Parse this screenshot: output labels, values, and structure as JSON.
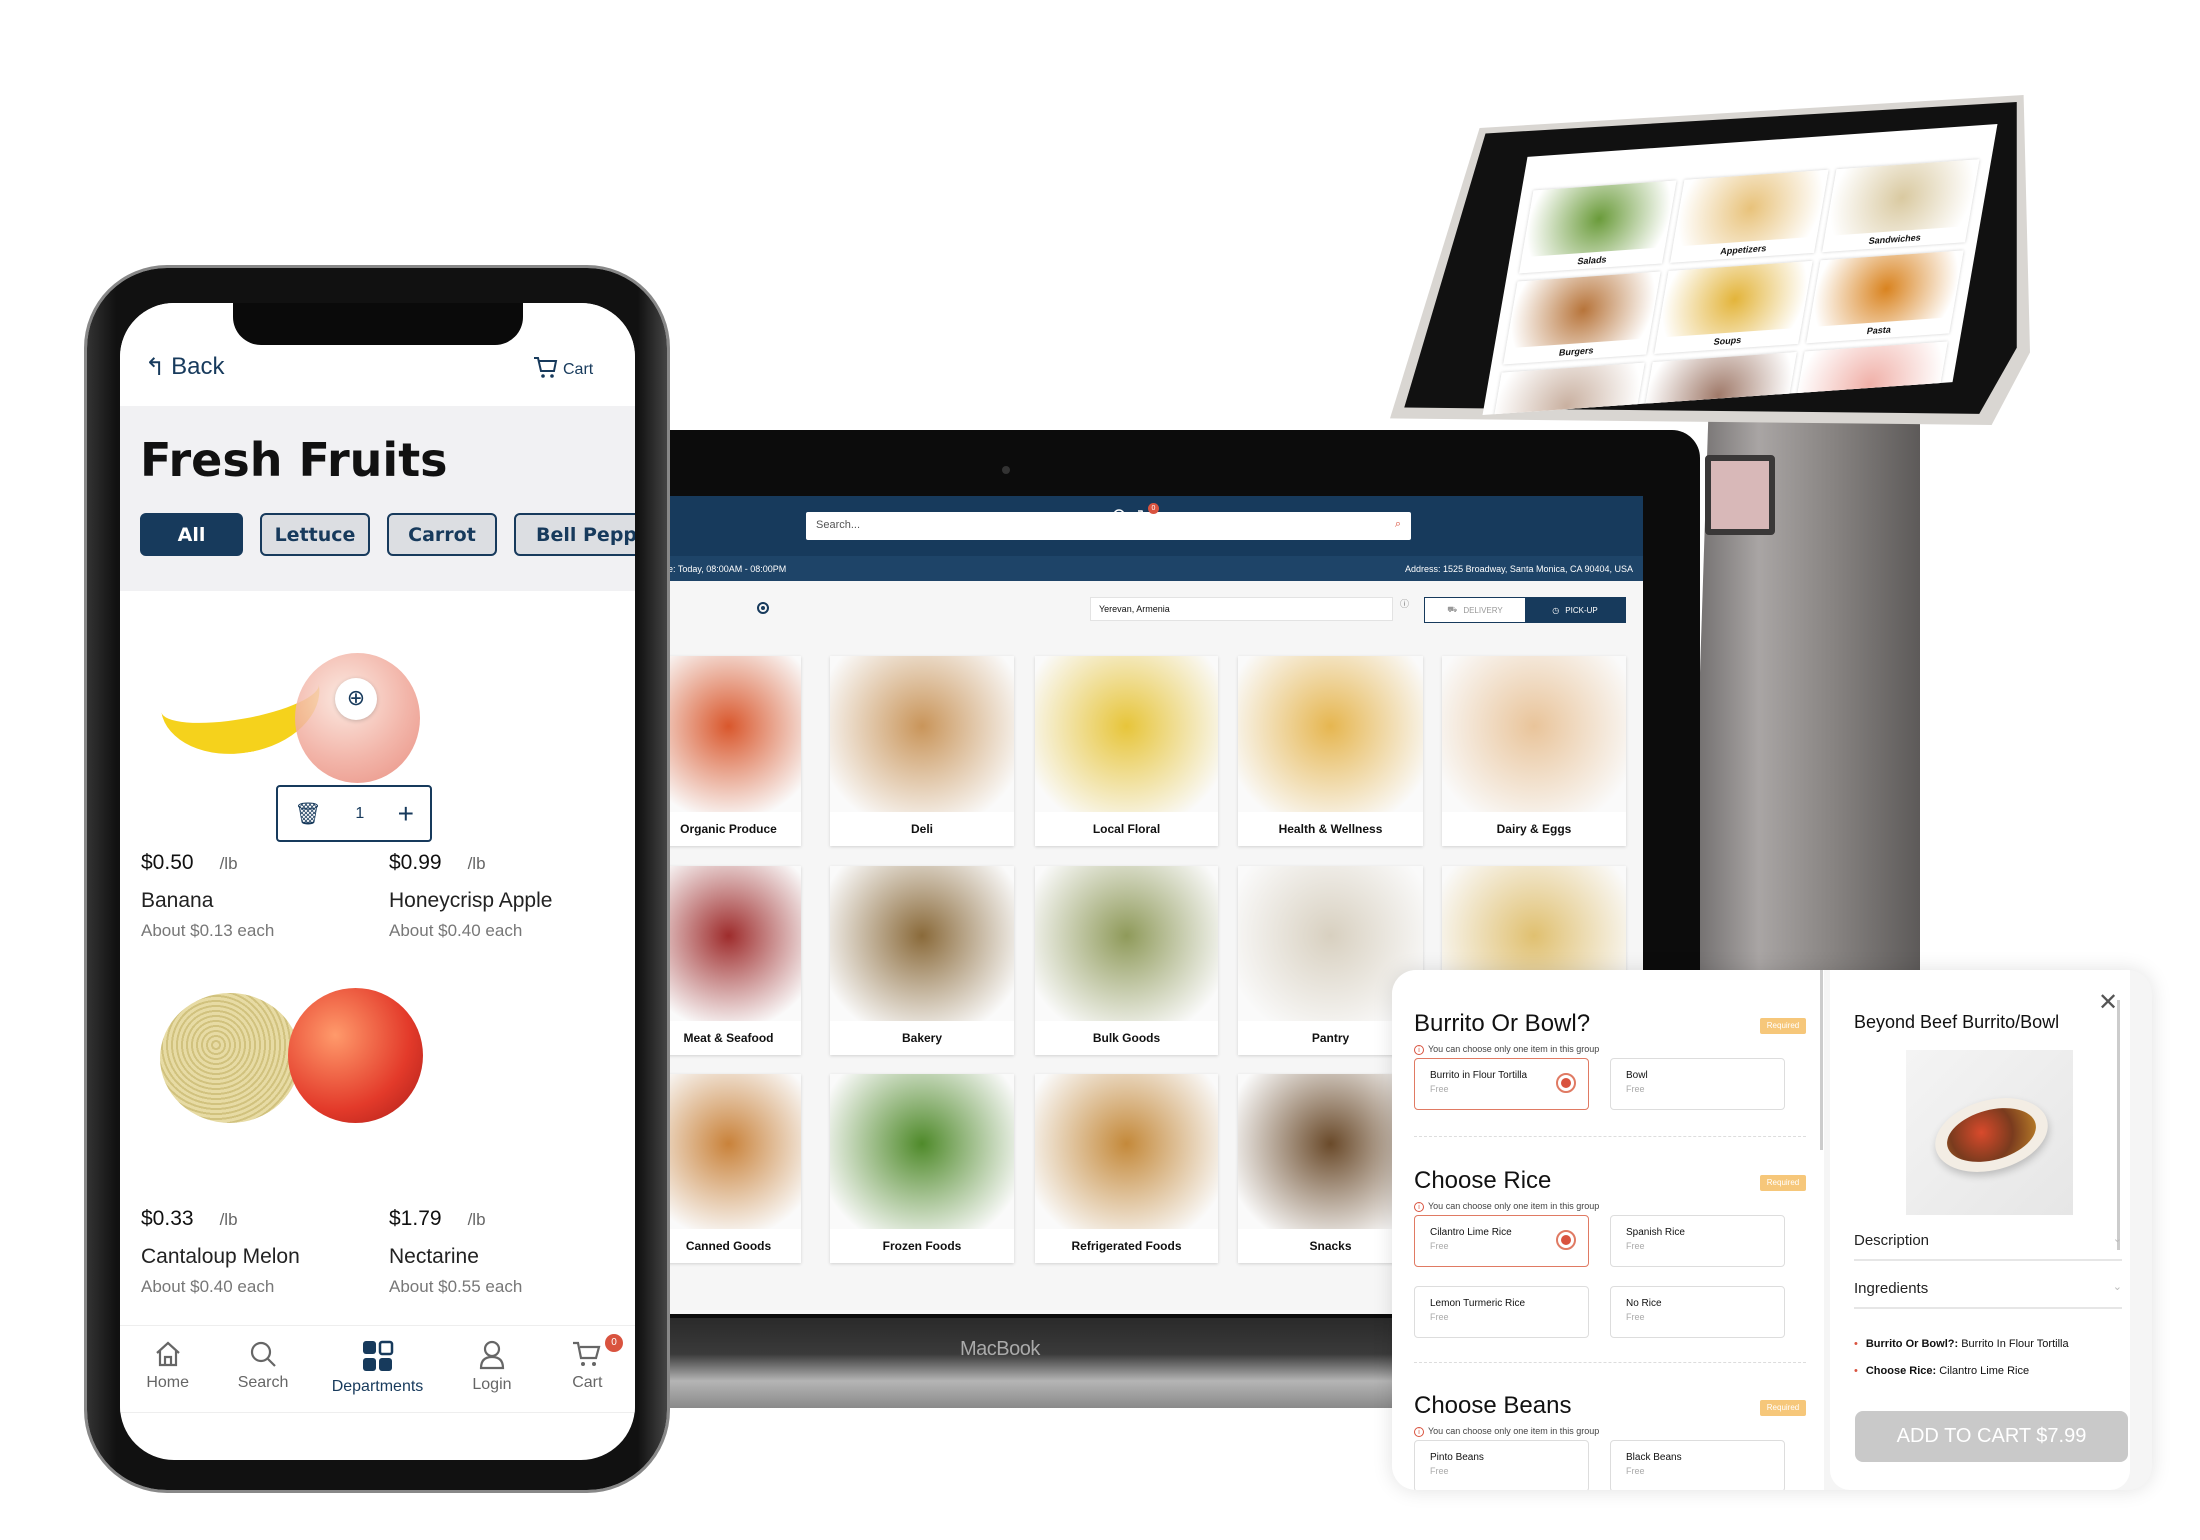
{
  "colors": {
    "brand": "#173a5c",
    "accent": "#d9533f",
    "required": "#f6c77a"
  },
  "kiosk": {
    "categories": [
      "Salads",
      "Appetizers",
      "Sandwiches",
      "Burgers",
      "Soups",
      "Pasta",
      "",
      "",
      ""
    ]
  },
  "laptop": {
    "search_placeholder": "Search...",
    "cart_count": "0",
    "hours": "le: Today, 08:00AM - 08:00PM",
    "address": "Address: 1525 Broadway, Santa Monica, CA 90404, USA",
    "location": "Yerevan, Armenia",
    "delivery": "DELIVERY",
    "pickup": "PICK-UP",
    "brand_label": "MacBook",
    "categories": [
      "Organic Produce",
      "Deli",
      "Local Floral",
      "Health & Wellness",
      "Dairy & Eggs",
      "Meat & Seafood",
      "Bakery",
      "Bulk Goods",
      "Pantry",
      "",
      "Canned Goods",
      "Frozen Foods",
      "Refrigerated Foods",
      "Snacks",
      ""
    ]
  },
  "modal": {
    "groups": [
      {
        "title": "Burrito Or Bowl?",
        "required": "Required",
        "info": "You can choose only one item in this group",
        "options": [
          {
            "name": "Burrito in Flour Tortilla",
            "price": "Free",
            "selected": true
          },
          {
            "name": "Bowl",
            "price": "Free",
            "selected": false
          }
        ]
      },
      {
        "title": "Choose Rice",
        "required": "Required",
        "info": "You can choose only one item in this group",
        "options": [
          {
            "name": "Cilantro Lime Rice",
            "price": "Free",
            "selected": true
          },
          {
            "name": "Spanish Rice",
            "price": "Free",
            "selected": false
          },
          {
            "name": "Lemon Turmeric Rice",
            "price": "Free",
            "selected": false
          },
          {
            "name": "No Rice",
            "price": "Free",
            "selected": false
          }
        ]
      },
      {
        "title": "Choose Beans",
        "required": "Required",
        "info": "You can choose only one item in this group",
        "options": [
          {
            "name": "Pinto Beans",
            "price": "Free",
            "selected": false
          },
          {
            "name": "Black Beans",
            "price": "Free",
            "selected": false
          }
        ]
      }
    ],
    "item_title": "Beyond Beef Burrito/Bowl",
    "description": "Description",
    "ingredients": "Ingredients",
    "summary": [
      {
        "label": "Burrito Or Bowl?:",
        "value": "Burrito In Flour Tortilla"
      },
      {
        "label": "Choose Rice:",
        "value": "Cilantro Lime Rice"
      }
    ],
    "add_to_cart": "ADD TO CART $7.99"
  },
  "phone": {
    "back": "Back",
    "cart": "Cart",
    "title": "Fresh Fruits",
    "chips": [
      "All",
      "Lettuce",
      "Carrot",
      "Bell Pepp"
    ],
    "products": [
      {
        "price": "$0.50",
        "unit": "/lb",
        "name": "Banana",
        "about": "About $0.13 each"
      },
      {
        "price": "$0.99",
        "unit": "/lb",
        "name": "Honeycrisp Apple",
        "about": "About $0.40 each",
        "qty": "1"
      },
      {
        "price": "$0.33",
        "unit": "/lb",
        "name": "Cantaloup Melon",
        "about": "About $0.40 each"
      },
      {
        "price": "$1.79",
        "unit": "/lb",
        "name": "Nectarine",
        "about": "About $0.55 each"
      }
    ],
    "tabs": [
      "Home",
      "Search",
      "Departments",
      "Login",
      "Cart"
    ],
    "cart_badge": "0"
  }
}
